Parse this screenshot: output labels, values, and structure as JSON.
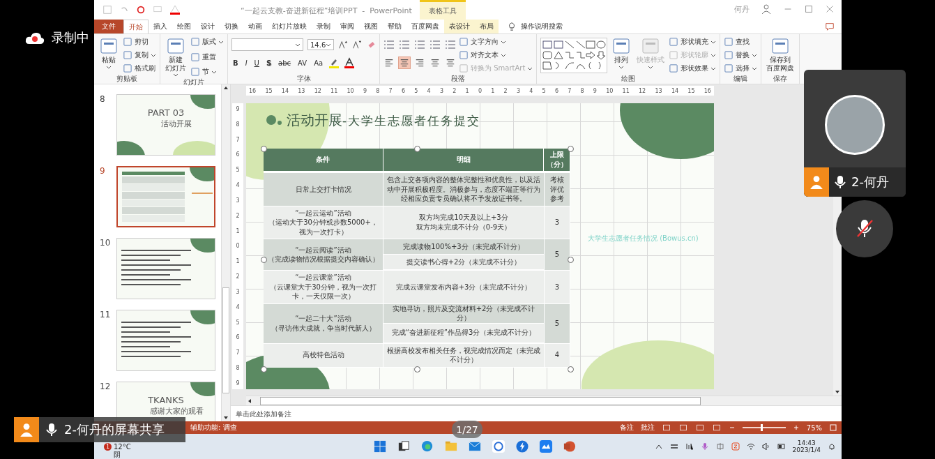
{
  "recording": {
    "label": "录制中"
  },
  "title_bar": {
    "title": "“一起云支教-奋进新征程”培训PPT  -  PowerPoint",
    "context_tab": "表格工具",
    "user": "何丹"
  },
  "tabs": [
    {
      "label": "文件",
      "kind": "file",
      "selected": false
    },
    {
      "label": "开始",
      "kind": "normal",
      "selected": true
    },
    {
      "label": "插入",
      "kind": "normal",
      "selected": false
    },
    {
      "label": "绘图",
      "kind": "normal",
      "selected": false
    },
    {
      "label": "设计",
      "kind": "normal",
      "selected": false
    },
    {
      "label": "切换",
      "kind": "normal",
      "selected": false
    },
    {
      "label": "动画",
      "kind": "normal",
      "selected": false
    },
    {
      "label": "幻灯片放映",
      "kind": "normal",
      "selected": false
    },
    {
      "label": "录制",
      "kind": "normal",
      "selected": false
    },
    {
      "label": "审阅",
      "kind": "normal",
      "selected": false
    },
    {
      "label": "视图",
      "kind": "normal",
      "selected": false
    },
    {
      "label": "帮助",
      "kind": "normal",
      "selected": false
    },
    {
      "label": "百度网盘",
      "kind": "normal",
      "selected": false
    },
    {
      "label": "表设计",
      "kind": "context",
      "selected": false
    },
    {
      "label": "布局",
      "kind": "context",
      "selected": false
    }
  ],
  "tell_me": {
    "placeholder": "操作说明搜索"
  },
  "ribbon": [
    {
      "label": "剪贴板",
      "kind": "standard",
      "commands": [
        {
          "label": [
            "粘贴"
          ],
          "kind": "large",
          "disabled": false,
          "dropdown": true
        },
        {
          "label": [
            "剪切"
          ],
          "kind": "small",
          "disabled": false,
          "dropdown": false
        },
        {
          "label": [
            "复制"
          ],
          "kind": "small",
          "disabled": false,
          "dropdown": true
        },
        {
          "label": [
            "格式刷"
          ],
          "kind": "small",
          "disabled": false,
          "dropdown": false
        }
      ]
    },
    {
      "label": "幻灯片",
      "kind": "standard",
      "commands": [
        {
          "label": [
            "新建",
            "幻灯片"
          ],
          "kind": "large",
          "disabled": false,
          "dropdown": true
        },
        {
          "label": [
            "版式"
          ],
          "kind": "small",
          "disabled": false,
          "dropdown": true
        },
        {
          "label": [
            "重置"
          ],
          "kind": "small",
          "disabled": false,
          "dropdown": false
        },
        {
          "label": [
            "节"
          ],
          "kind": "small",
          "disabled": false,
          "dropdown": true
        }
      ]
    },
    {
      "label": "字体",
      "kind": "font",
      "font_size": "14.6",
      "format_buttons": [
        "B",
        "I",
        "U",
        "S",
        "abc",
        "AV",
        "Aa"
      ]
    },
    {
      "label": "段落",
      "kind": "paragraph",
      "alignment": [
        {
          "selected": false
        },
        {
          "selected": true
        },
        {
          "selected": false
        },
        {
          "selected": false
        },
        {
          "selected": false
        }
      ],
      "commands": [
        {
          "label": [
            "文字方向"
          ],
          "kind": "small",
          "disabled": false,
          "dropdown": true
        },
        {
          "label": [
            "对齐文本"
          ],
          "kind": "small",
          "disabled": false,
          "dropdown": true
        },
        {
          "label": [
            "转换为 SmartArt"
          ],
          "kind": "small",
          "disabled": true,
          "dropdown": true
        }
      ]
    },
    {
      "label": "绘图",
      "kind": "drawing",
      "commands": [
        {
          "label": [
            "排列"
          ],
          "kind": "large",
          "disabled": false,
          "dropdown": true
        },
        {
          "label": [
            "快速样式"
          ],
          "kind": "large",
          "disabled": true,
          "dropdown": true
        },
        {
          "label": [
            "形状填充"
          ],
          "kind": "small",
          "disabled": false,
          "dropdown": true
        },
        {
          "label": [
            "形状轮廓"
          ],
          "kind": "small",
          "disabled": true,
          "dropdown": true
        },
        {
          "label": [
            "形状效果"
          ],
          "kind": "small",
          "disabled": false,
          "dropdown": true
        }
      ]
    },
    {
      "label": "编辑",
      "kind": "standard",
      "commands": [
        {
          "label": [
            "查找"
          ],
          "kind": "small",
          "disabled": false,
          "dropdown": false
        },
        {
          "label": [
            "替换"
          ],
          "kind": "small",
          "disabled": false,
          "dropdown": true
        },
        {
          "label": [
            "选择"
          ],
          "kind": "small",
          "disabled": false,
          "dropdown": true
        }
      ]
    },
    {
      "label": "保存",
      "kind": "standard",
      "commands": [
        {
          "label": [
            "保存到",
            "百度网盘"
          ],
          "kind": "large",
          "disabled": false,
          "dropdown": false
        }
      ]
    }
  ],
  "slides": [
    {
      "number": "8",
      "kind": "title",
      "selected": false,
      "texts": [
        "PART 03",
        "活动开展"
      ]
    },
    {
      "number": "9",
      "kind": "table",
      "selected": true
    },
    {
      "number": "10",
      "kind": "text",
      "selected": false
    },
    {
      "number": "11",
      "kind": "text",
      "selected": false
    },
    {
      "number": "12",
      "kind": "title",
      "selected": false,
      "texts": [
        "TKANKS",
        "感谢大家的观看"
      ]
    }
  ],
  "rulers": {
    "horizontal": [
      "16",
      "15",
      "14",
      "13",
      "12",
      "11",
      "10",
      "9",
      "8",
      "7",
      "6",
      "5",
      "4",
      "3",
      "2",
      "1",
      "0",
      "1",
      "2",
      "3",
      "4",
      "5",
      "6",
      "7",
      "8",
      "9",
      "10",
      "11",
      "12",
      "13",
      "14",
      "15",
      "16"
    ],
    "vertical": [
      "9",
      "8",
      "7",
      "6",
      "5",
      "4",
      "3",
      "2",
      "1",
      "0",
      "1",
      "2",
      "3",
      "4",
      "5",
      "6",
      "7",
      "8",
      "9"
    ]
  },
  "slide": {
    "title": "活动开展",
    "subtitle": "-大学生志愿者任务提交",
    "side_link": "大学生志愿者任务情况 (Bowus.cn)",
    "table": {
      "columns": [
        "条件",
        "明细",
        "上限（分）"
      ],
      "rows": [
        {
          "condition": [
            "日常上交打卡情况"
          ],
          "details": [
            [
              "包含上交各项内容的整体完整性和优良性，以及活动中开展积极程度。消极参与，态度不端正等行为经相应负责专员确认将不予发放证书等。"
            ]
          ],
          "limit": "考核评优参考"
        },
        {
          "condition": [
            "“一起云运动”活动",
            "（运动大于30分钟或步数5000+，视为一次打卡）"
          ],
          "details": [
            [
              "双方均完成10天及以上+3分",
              "双方均未完成不计分（0-9天）"
            ]
          ],
          "limit": "3"
        },
        {
          "condition": [
            "“一起云阅读”活动",
            "（完成读物情况根据提交内容确认）"
          ],
          "details": [
            [
              "完成读物100%+3分（未完成不计分）"
            ],
            [
              "提交读书心得+2分（未完成不计分）"
            ]
          ],
          "limit": "5"
        },
        {
          "condition": [
            "“一起云课堂”活动",
            "（云课堂大于30分钟，视为一次打卡，一天仅限一次）"
          ],
          "details": [
            [
              "完成云课堂发布内容+3分（未完成不计分）"
            ]
          ],
          "limit": "3"
        },
        {
          "condition": [
            "“一起二十大”活动",
            "（寻访伟大成就，争当时代新人）"
          ],
          "details": [
            [
              "实地寻访，照片及交流材料+2分（未完成不计分）"
            ],
            [
              "完成“奋进新征程”作品得3分（未完成不计分）"
            ]
          ],
          "limit": "5"
        },
        {
          "condition": [
            "高校特色活动"
          ],
          "details": [
            [
              "根据高校发布相关任务，视完成情况而定（未完成不计分）"
            ]
          ],
          "limit": "4"
        }
      ]
    }
  },
  "notes": {
    "placeholder": "单击此处添加备注"
  },
  "status_bar": {
    "accessibility": "辅助功能: 调查",
    "notes": "备注",
    "comments": "批注",
    "zoom": {
      "level": 0.42,
      "reading": "75%"
    }
  },
  "taskbar": {
    "weather": {
      "badge": "1",
      "temperature": "12°C",
      "condition": "阴"
    },
    "time": "14:43",
    "date": "2023/1/4"
  },
  "page_counter": "1/27",
  "video_tile": {
    "name": "2-何丹"
  },
  "screen_share": {
    "label": "2-何丹的屏幕共享"
  }
}
